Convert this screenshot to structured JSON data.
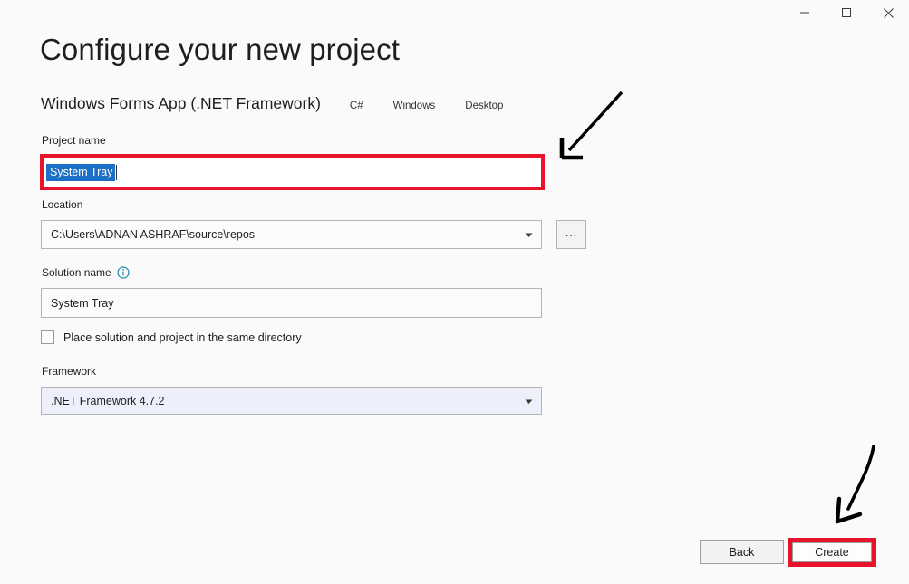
{
  "window": {
    "controls": [
      {
        "name": "minimize",
        "glyph": "minimize-icon"
      },
      {
        "name": "maximize",
        "glyph": "maximize-icon"
      },
      {
        "name": "close",
        "glyph": "close-icon"
      }
    ]
  },
  "header": {
    "title": "Configure your new project",
    "template_name": "Windows Forms App (.NET Framework)",
    "tags": [
      "C#",
      "Windows",
      "Desktop"
    ]
  },
  "form": {
    "project_name": {
      "label": "Project name",
      "value": "System Tray",
      "selected": true,
      "highlight_color": "#e8142a",
      "selection_color": "#1b6fc4"
    },
    "location": {
      "label": "Location",
      "value": "C:\\Users\\ADNAN ASHRAF\\source\\repos",
      "browse_label": "..."
    },
    "solution_name": {
      "label": "Solution name",
      "info_tooltip_icon": "info-circle-icon",
      "value": "System Tray"
    },
    "same_directory": {
      "label": "Place solution and project in the same directory",
      "checked": false
    },
    "framework": {
      "label": "Framework",
      "value": ".NET Framework 4.7.2"
    }
  },
  "footer": {
    "back_label": "Back",
    "create_label": "Create",
    "create_highlight_color": "#e8142a"
  },
  "annotations": [
    {
      "name": "arrow-to-project-name",
      "direction": "down-left"
    },
    {
      "name": "arrow-to-create-button",
      "direction": "down-left"
    }
  ],
  "colors": {
    "page_background": "#fafafa",
    "accent_blue": "#1b6fc4",
    "annotation_red": "#e8142a",
    "info_icon": "#1b8ca8"
  }
}
